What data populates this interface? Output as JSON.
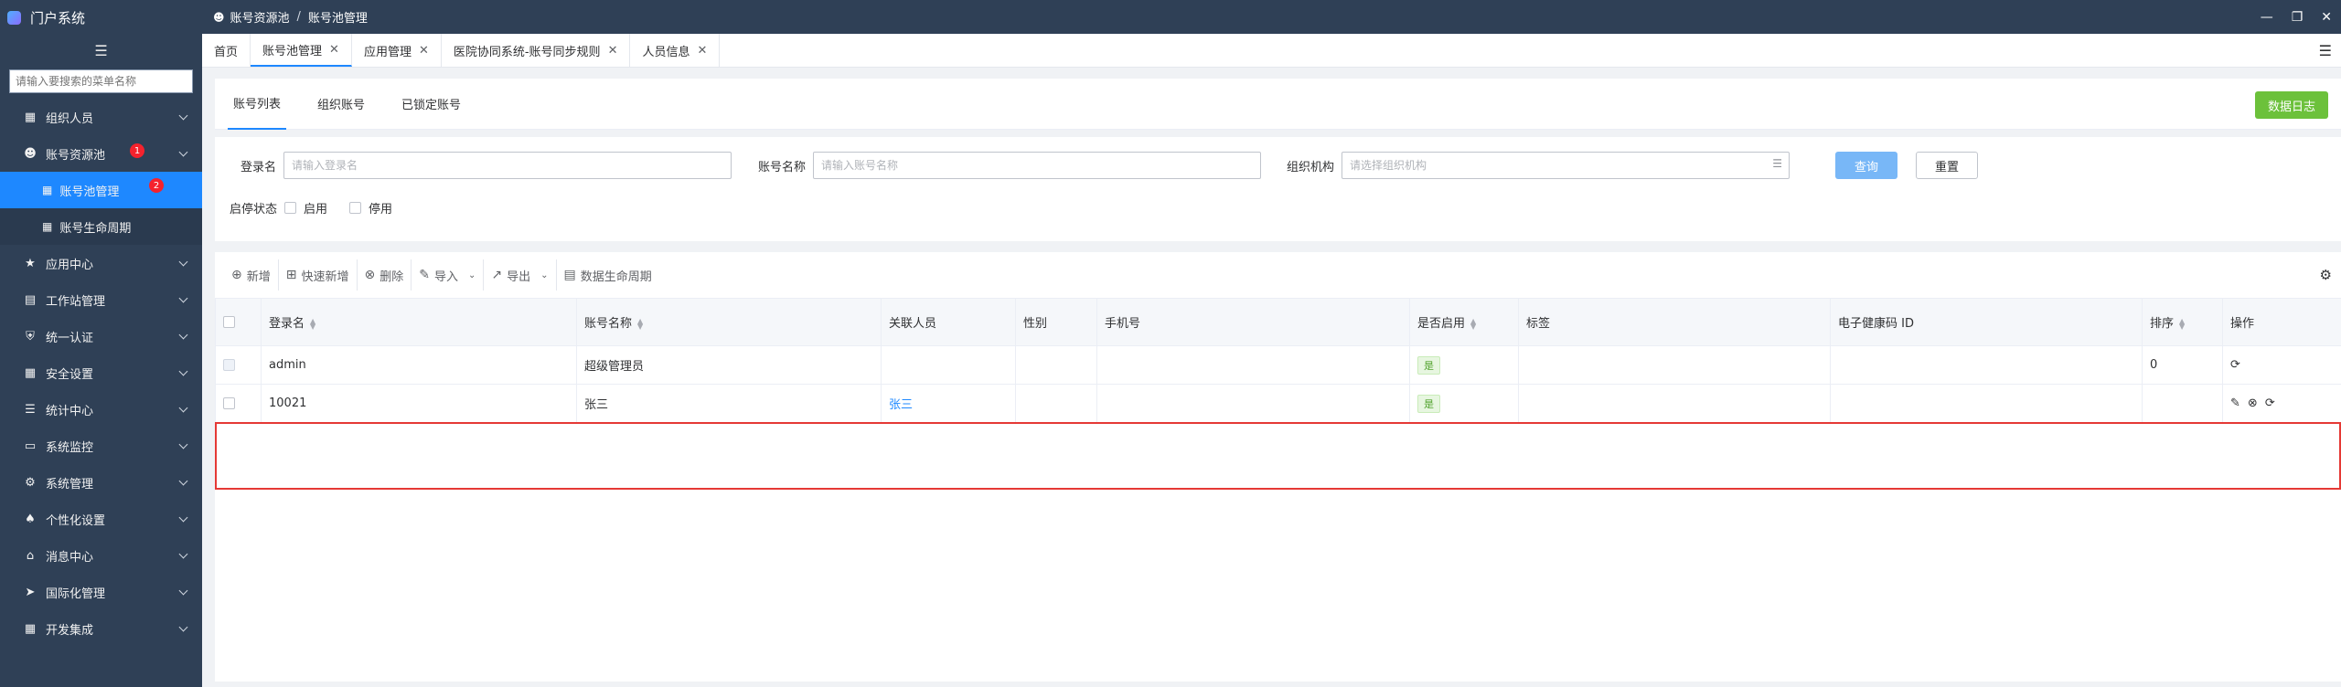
{
  "app": {
    "title": "门户系统"
  },
  "breadcrumb": {
    "level1": "账号资源池",
    "level2": "账号池管理"
  },
  "sidebar": {
    "search_placeholder": "请输入要搜索的菜单名称",
    "items": [
      {
        "label": "组织人员",
        "icon": "grid-icon"
      },
      {
        "label": "账号资源池",
        "icon": "user-icon",
        "badge": "1"
      },
      {
        "label": "应用中心",
        "icon": "star-icon"
      },
      {
        "label": "工作站管理",
        "icon": "workstation-icon"
      },
      {
        "label": "统一认证",
        "icon": "shield-icon"
      },
      {
        "label": "安全设置",
        "icon": "grid-icon"
      },
      {
        "label": "统计中心",
        "icon": "list-icon"
      },
      {
        "label": "系统监控",
        "icon": "monitor-icon"
      },
      {
        "label": "系统管理",
        "icon": "system-icon"
      },
      {
        "label": "个性化设置",
        "icon": "personalize-icon"
      },
      {
        "label": "消息中心",
        "icon": "home-icon"
      },
      {
        "label": "国际化管理",
        "icon": "send-icon"
      },
      {
        "label": "开发集成",
        "icon": "grid-icon"
      }
    ],
    "subitems": [
      {
        "label": "账号池管理",
        "badge": "2",
        "active": true
      },
      {
        "label": "账号生命周期"
      }
    ]
  },
  "tabs": [
    {
      "label": "首页"
    },
    {
      "label": "账号池管理"
    },
    {
      "label": "应用管理"
    },
    {
      "label": "医院协同系统-账号同步规则"
    },
    {
      "label": "人员信息"
    }
  ],
  "subtabs": {
    "list": "账号列表",
    "org": "组织账号",
    "locked": "已锁定账号"
  },
  "log_button": "数据日志",
  "filters": {
    "login_label": "登录名",
    "login_placeholder": "请输入登录名",
    "account_label": "账号名称",
    "account_placeholder": "请输入账号名称",
    "org_label": "组织机构",
    "org_placeholder": "请选择组织机构",
    "query": "查询",
    "reset": "重置",
    "status_label": "启停状态",
    "enabled": "启用",
    "disabled": "停用"
  },
  "toolbar": {
    "add": "新增",
    "quick_add": "快速新增",
    "delete": "删除",
    "import": "导入",
    "export": "导出",
    "lifecycle": "数据生命周期"
  },
  "table": {
    "headers": [
      "登录名",
      "账号名称",
      "关联人员",
      "性别",
      "手机号",
      "是否启用",
      "标签",
      "电子健康码 ID",
      "排序",
      "操作"
    ],
    "rows": [
      {
        "login": "admin",
        "account": "超级管理员",
        "person": "",
        "gender": "",
        "phone": "",
        "enabled": "是",
        "tag": "",
        "health_id": "",
        "order": "0"
      },
      {
        "login": "10021",
        "account": "张三",
        "person": "张三",
        "gender": "",
        "phone": "",
        "enabled": "是",
        "tag": "",
        "health_id": "",
        "order": ""
      }
    ]
  },
  "colors": {
    "sidebar_bg": "#2f4056",
    "accent": "#1e88ff",
    "success": "#6cc13b",
    "danger": "#e53935"
  }
}
